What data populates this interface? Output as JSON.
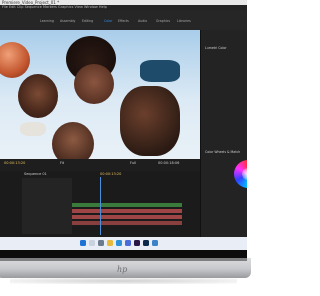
{
  "window": {
    "title": "Premiere_Video_Project_01 *",
    "menu": "File Edit Clip Sequence Markers Graphics View Window Help"
  },
  "workspaces": [
    {
      "label": "Learning"
    },
    {
      "label": "Assembly"
    },
    {
      "label": "Editing"
    },
    {
      "label": "Color",
      "active": true
    },
    {
      "label": "Effects"
    },
    {
      "label": "Audio"
    },
    {
      "label": "Graphics"
    },
    {
      "label": "Libraries"
    }
  ],
  "viewer": {
    "timecode_left": "00:00:13:20",
    "fit": "Fit",
    "quality": "Full",
    "timecode_right": "00:00:18:06"
  },
  "timeline": {
    "sequence_name": "Sequence 01",
    "timecode": "00:00:13:20"
  },
  "lumetri": {
    "panel_title": "Lumetri Color",
    "section": "Color Wheels & Match"
  },
  "colors": {
    "accent": "#2d8ceb",
    "timecode": "#e8c15a",
    "clip_video": "#3a7a3a",
    "clip_audio": "#a04545",
    "panel_bg": "#1d1d1d"
  },
  "icons": [
    "start-icon",
    "search-icon",
    "task-view-icon",
    "folder-icon",
    "edge-icon",
    "store-icon",
    "premiere-icon",
    "photoshop-icon",
    "mail-icon"
  ]
}
